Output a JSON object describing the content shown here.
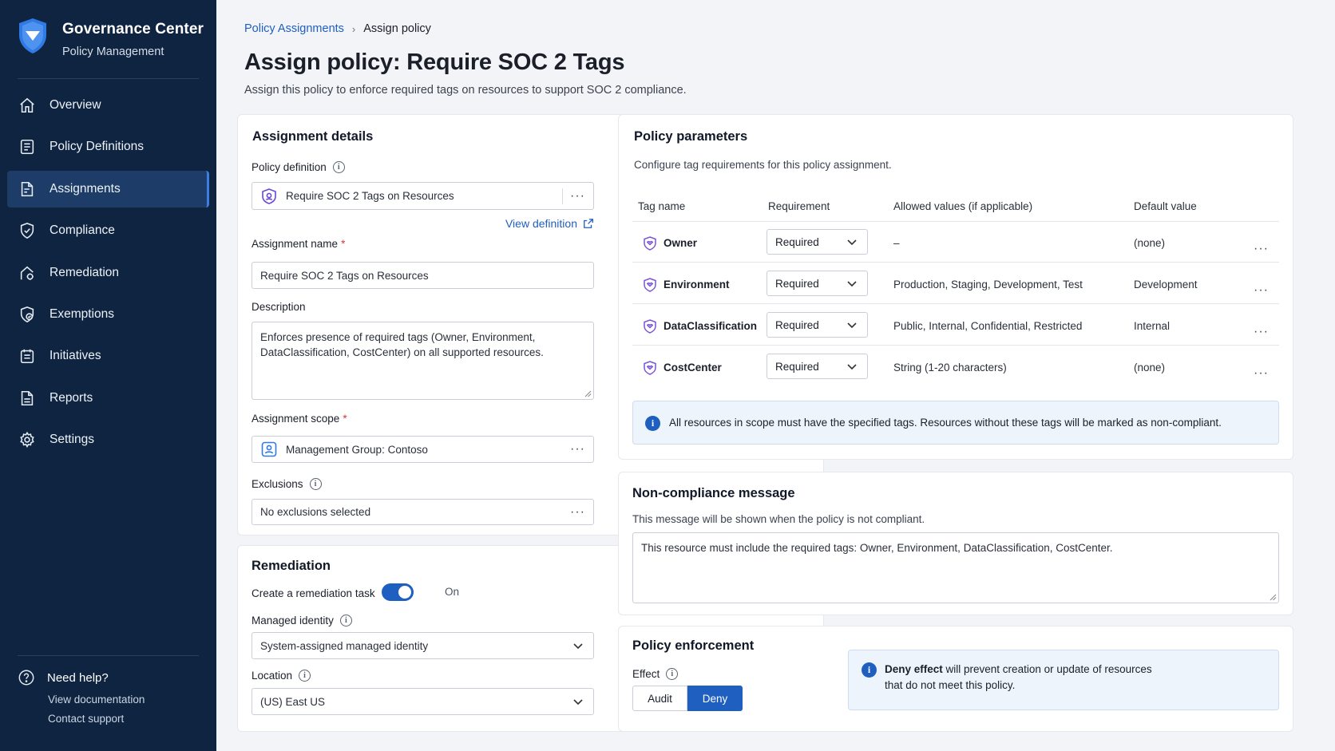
{
  "sidebar": {
    "brand_title": "Governance Center",
    "brand_subtitle": "Policy Management",
    "items": [
      {
        "label": "Overview",
        "icon": "home-icon"
      },
      {
        "label": "Policy Definitions",
        "icon": "list-icon"
      },
      {
        "label": "Assignments",
        "icon": "assignment-icon",
        "active": true
      },
      {
        "label": "Compliance",
        "icon": "shield-check-icon"
      },
      {
        "label": "Remediation",
        "icon": "remediation-icon"
      },
      {
        "label": "Exemptions",
        "icon": "exemption-icon"
      },
      {
        "label": "Initiatives",
        "icon": "initiative-icon"
      },
      {
        "label": "Reports",
        "icon": "report-icon"
      },
      {
        "label": "Settings",
        "icon": "gear-icon"
      }
    ],
    "help": {
      "title": "Need help?",
      "doc_link": "View documentation",
      "support_link": "Contact support"
    }
  },
  "breadcrumb": {
    "parent": "Policy Assignments",
    "current": "Assign policy"
  },
  "page": {
    "title": "Assign policy: Require SOC 2 Tags",
    "description": "Assign this policy to enforce required tags on resources to support SOC 2 compliance."
  },
  "assignment": {
    "title": "Assignment details",
    "policy_definition_label": "Policy definition",
    "policy_definition_value": "Require SOC 2 Tags on Resources",
    "view_definition": "View definition",
    "name_label": "Assignment name",
    "name_value": "Require SOC 2 Tags on Resources",
    "description_label": "Description",
    "description_value": "Enforces presence of required tags (Owner, Environment, DataClassification, CostCenter) on all supported resources.",
    "scope_label": "Assignment scope",
    "scope_value": "Management Group: Contoso",
    "exclusions_label": "Exclusions",
    "exclusions_value": "No exclusions selected"
  },
  "remediation": {
    "title": "Remediation",
    "task_label": "Create a remediation task",
    "task_state": "On",
    "identity_label": "Managed identity",
    "identity_value": "System-assigned managed identity",
    "location_label": "Location",
    "location_value": "(US) East US"
  },
  "parameters": {
    "title": "Policy parameters",
    "subtitle": "Configure tag requirements for this policy assignment.",
    "columns": [
      "Tag name",
      "Requirement",
      "Allowed values (if applicable)",
      "Default value"
    ],
    "rows": [
      {
        "tag": "Owner",
        "requirement": "Required",
        "allowed": "–",
        "default": "(none)"
      },
      {
        "tag": "Environment",
        "requirement": "Required",
        "allowed": "Production, Staging, Development, Test",
        "default": "Development"
      },
      {
        "tag": "DataClassification",
        "requirement": "Required",
        "allowed": "Public, Internal, Confidential, Restricted",
        "default": "Internal"
      },
      {
        "tag": "CostCenter",
        "requirement": "Required",
        "allowed": "String (1-20 characters)",
        "default": "(none)"
      }
    ],
    "info": "All resources in scope must have the specified tags. Resources without these tags will be marked as non-compliant."
  },
  "noncompliance": {
    "title": "Non-compliance message",
    "subtitle": "This message will be shown when the policy is not compliant.",
    "message": "This resource must include the required tags: Owner, Environment, DataClassification, CostCenter."
  },
  "enforcement": {
    "title": "Policy enforcement",
    "effect_label": "Effect",
    "options": [
      "Audit",
      "Deny"
    ],
    "selected": "Deny",
    "info_bold": "Deny effect",
    "info_rest": " will prevent creation or update of resources",
    "info_line2": "that do not meet this policy."
  },
  "colors": {
    "sidebar_bg": "#0e2440",
    "accent": "#1f5fbf",
    "tag_icon": "#7b52d6"
  }
}
